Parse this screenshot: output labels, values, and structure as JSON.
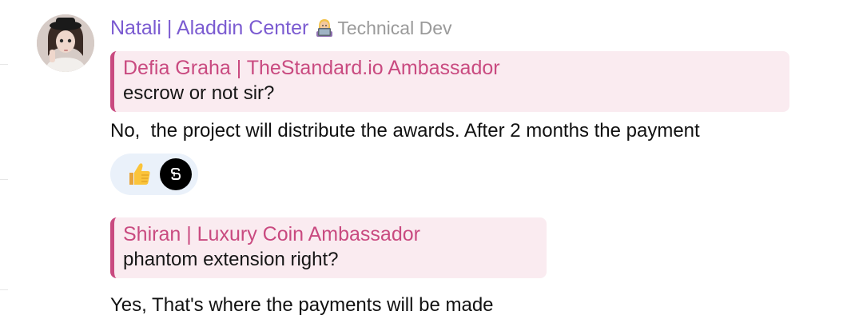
{
  "message": {
    "sender_name": "Natali | Aladdin Center",
    "role_emoji": "woman-technologist-icon",
    "role_label": "Technical Dev",
    "colors": {
      "sender": "#7b5bd1",
      "quote_accent": "#c94a80",
      "quote_bg": "#faebf0",
      "reaction_bg": "#eaf1fa",
      "role": "#9a9a9a"
    },
    "replies": [
      {
        "quoted_author": "Defia Graha | TheStandard.io Ambassador",
        "quoted_text": "escrow or not sir?",
        "text": "No,  the project will distribute the awards. After 2 months the payment",
        "reactions": [
          {
            "emoji": "thumbs-up-icon"
          },
          {
            "avatar": "reactor-avatar"
          }
        ]
      },
      {
        "quoted_author": "Shiran | Luxury Coin Ambassador",
        "quoted_text": "phantom extension right?",
        "text": "Yes, That's where the payments will be made"
      }
    ]
  }
}
